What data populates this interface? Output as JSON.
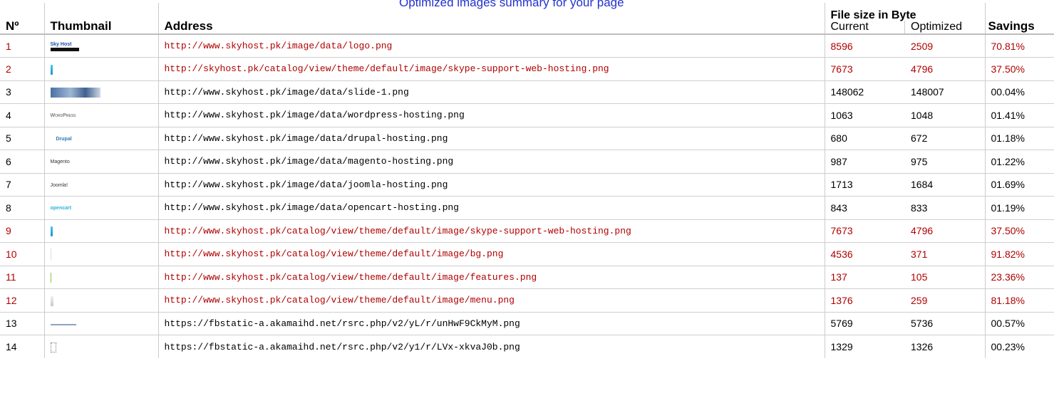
{
  "top_link": "Optimized images summary for your page",
  "headers": {
    "no": "Nº",
    "thumbnail": "Thumbnail",
    "address": "Address",
    "file_size": "File size in Byte",
    "current": "Current",
    "optimized": "Optimized",
    "savings": "Savings"
  },
  "colors": {
    "highlight_red": "#b00000",
    "link_blue": "#2233cc"
  },
  "rows": [
    {
      "no": "1",
      "thumb": "skyhost-logo-thumbnail",
      "thumb_text": "Sky Host",
      "address": "http://www.skyhost.pk/image/data/logo.png",
      "current": "8596",
      "optimized": "2509",
      "savings": "70.81%",
      "highlight": true
    },
    {
      "no": "2",
      "thumb": "skype-support-thumbnail",
      "thumb_text": "",
      "address": "http://skyhost.pk/catalog/view/theme/default/image/skype-support-web-hosting.png",
      "current": "7673",
      "optimized": "4796",
      "savings": "37.50%",
      "highlight": true
    },
    {
      "no": "3",
      "thumb": "slide-thumbnail",
      "thumb_text": "",
      "address": "http://www.skyhost.pk/image/data/slide-1.png",
      "current": "148062",
      "optimized": "148007",
      "savings": "00.04%",
      "highlight": false
    },
    {
      "no": "4",
      "thumb": "wordpress-thumbnail",
      "thumb_text": "WordPress",
      "address": "http://www.skyhost.pk/image/data/wordpress-hosting.png",
      "current": "1063",
      "optimized": "1048",
      "savings": "01.41%",
      "highlight": false
    },
    {
      "no": "5",
      "thumb": "drupal-thumbnail",
      "thumb_text": "Drupal",
      "address": "http://www.skyhost.pk/image/data/drupal-hosting.png",
      "current": "680",
      "optimized": "672",
      "savings": "01.18%",
      "highlight": false
    },
    {
      "no": "6",
      "thumb": "magento-thumbnail",
      "thumb_text": "Magento",
      "address": "http://www.skyhost.pk/image/data/magento-hosting.png",
      "current": "987",
      "optimized": "975",
      "savings": "01.22%",
      "highlight": false
    },
    {
      "no": "7",
      "thumb": "joomla-thumbnail",
      "thumb_text": "Joomla!",
      "address": "http://www.skyhost.pk/image/data/joomla-hosting.png",
      "current": "1713",
      "optimized": "1684",
      "savings": "01.69%",
      "highlight": false
    },
    {
      "no": "8",
      "thumb": "opencart-thumbnail",
      "thumb_text": "opencart",
      "address": "http://www.skyhost.pk/image/data/opencart-hosting.png",
      "current": "843",
      "optimized": "833",
      "savings": "01.19%",
      "highlight": false
    },
    {
      "no": "9",
      "thumb": "skype-support-thumbnail",
      "thumb_text": "",
      "address": "http://www.skyhost.pk/catalog/view/theme/default/image/skype-support-web-hosting.png",
      "current": "7673",
      "optimized": "4796",
      "savings": "37.50%",
      "highlight": true
    },
    {
      "no": "10",
      "thumb": "bg-thumbnail",
      "thumb_text": "",
      "address": "http://www.skyhost.pk/catalog/view/theme/default/image/bg.png",
      "current": "4536",
      "optimized": "371",
      "savings": "91.82%",
      "highlight": true
    },
    {
      "no": "11",
      "thumb": "features-thumbnail",
      "thumb_text": "",
      "address": "http://www.skyhost.pk/catalog/view/theme/default/image/features.png",
      "current": "137",
      "optimized": "105",
      "savings": "23.36%",
      "highlight": true
    },
    {
      "no": "12",
      "thumb": "menu-thumbnail",
      "thumb_text": "",
      "address": "http://www.skyhost.pk/catalog/view/theme/default/image/menu.png",
      "current": "1376",
      "optimized": "259",
      "savings": "81.18%",
      "highlight": true
    },
    {
      "no": "13",
      "thumb": "fb-line-thumbnail",
      "thumb_text": "",
      "address": "https://fbstatic-a.akamaihd.net/rsrc.php/v2/yL/r/unHwF9CkMyM.png",
      "current": "5769",
      "optimized": "5736",
      "savings": "00.57%",
      "highlight": false
    },
    {
      "no": "14",
      "thumb": "fb-icon-thumbnail",
      "thumb_text": "",
      "address": "https://fbstatic-a.akamaihd.net/rsrc.php/v2/y1/r/LVx-xkvaJ0b.png",
      "current": "1329",
      "optimized": "1326",
      "savings": "00.23%",
      "highlight": false
    }
  ]
}
